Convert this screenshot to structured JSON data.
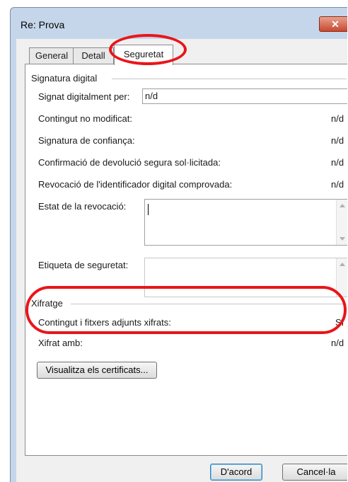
{
  "window": {
    "title": "Re: Prova"
  },
  "tabs": [
    {
      "label": "General"
    },
    {
      "label": "Detall"
    },
    {
      "label": "Seguretat",
      "active": true
    }
  ],
  "signatura": {
    "group_title": "Signatura digital",
    "signed_by_label": "Signat digitalment per:",
    "signed_by_value": "n/d",
    "rows": [
      {
        "label": "Contingut no modificat:",
        "value": "n/d"
      },
      {
        "label": "Signatura de confiança:",
        "value": "n/d"
      },
      {
        "label": "Confirmació de devolució segura sol·licitada:",
        "value": "n/d"
      },
      {
        "label": "Revocació de l'identificador digital comprovada:",
        "value": "n/d"
      }
    ],
    "revocation_state_label": "Estat de la revocació:",
    "security_label_label": "Etiqueta de seguretat:"
  },
  "xifratge": {
    "group_title": "Xifratge",
    "rows": [
      {
        "label": "Contingut i fitxers adjunts xifrats:",
        "value": "Sí"
      },
      {
        "label": "Xifrat amb:",
        "value": "n/d"
      }
    ]
  },
  "buttons": {
    "view_certificates": "Visualitza els certificats...",
    "ok": "D'acord",
    "cancel": "Cancel·la"
  },
  "annotation_color": "#e8161a"
}
